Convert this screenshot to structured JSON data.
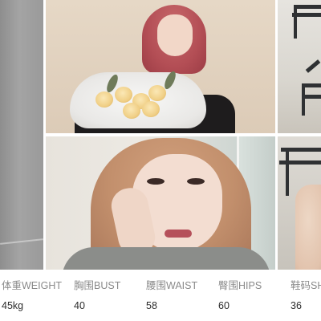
{
  "measurements": [
    {
      "label": "体重WEIGHT",
      "value": "45kg"
    },
    {
      "label": "胸围BUST",
      "value": "40"
    },
    {
      "label": "腰围WAIST",
      "value": "58"
    },
    {
      "label": "臀围HIPS",
      "value": "60"
    },
    {
      "label": "鞋码SH",
      "value": "36"
    }
  ],
  "colors": {
    "label": "#8a8a8a",
    "value": "#2b2b2b",
    "background": "#ffffff"
  }
}
